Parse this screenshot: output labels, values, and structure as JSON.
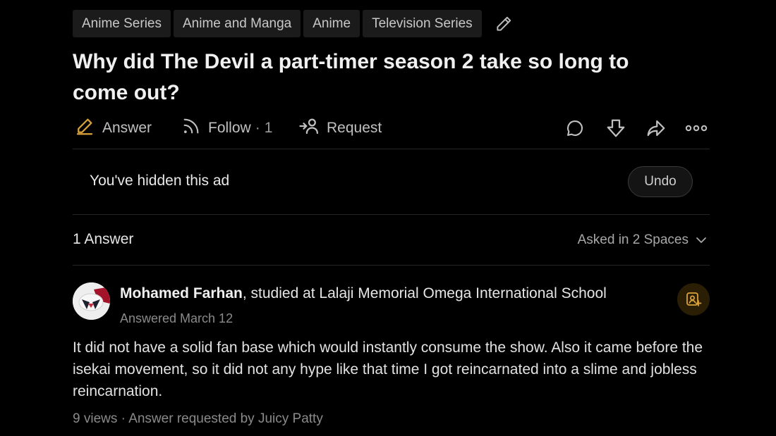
{
  "topics": [
    "Anime Series",
    "Anime and Manga",
    "Anime",
    "Television Series"
  ],
  "question": {
    "title": "Why did The Devil a part-timer season 2 take so long to come out?"
  },
  "actions": {
    "answer_label": "Answer",
    "follow_label": "Follow",
    "follow_separator": "·",
    "follow_count": "1",
    "request_label": "Request"
  },
  "ad": {
    "hidden_text": "You've hidden this ad",
    "undo_label": "Undo"
  },
  "answers_header": {
    "count_label": "1 Answer",
    "spaces_label": "Asked in 2 Spaces"
  },
  "answer": {
    "author_name": "Mohamed Farhan",
    "author_credential": ", studied at Lalaji Memorial Omega International School",
    "date": "Answered March 12",
    "body": "It did not have a solid fan base which would instantly consume the show. Also it came before the isekai movement, so it did not any hype like that time I got reincarnated into a slime and jobless reincarnation.",
    "meta": "9 views · Answer requested by Juicy Patty"
  },
  "colors": {
    "background": "#000000",
    "answer_icon_accent": "#d9a23a",
    "request_badge_bg": "#2a1e05"
  },
  "icons": [
    "edit-icon",
    "answer-icon",
    "follow-icon",
    "request-icon",
    "comment-icon",
    "downvote-icon",
    "share-icon",
    "more-icon",
    "chevron-down-icon",
    "request-answer-icon"
  ]
}
